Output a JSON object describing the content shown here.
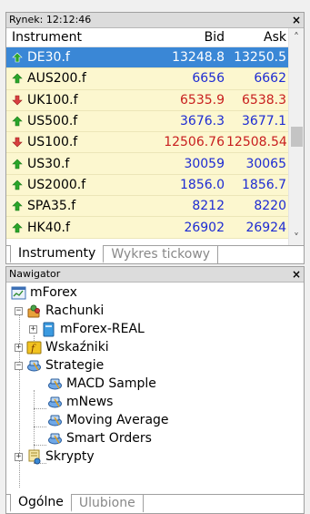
{
  "market_watch": {
    "title": "Rynek: 12:12:46",
    "close": "×",
    "columns": {
      "instrument": "Instrument",
      "bid": "Bid",
      "ask": "Ask"
    },
    "rows": [
      {
        "symbol": "DE30.f",
        "bid": "13248.8",
        "ask": "13250.5",
        "dir": "up",
        "selected": true
      },
      {
        "symbol": "AUS200.f",
        "bid": "6656",
        "ask": "6662",
        "dir": "up"
      },
      {
        "symbol": "UK100.f",
        "bid": "6535.9",
        "ask": "6538.3",
        "dir": "down"
      },
      {
        "symbol": "US500.f",
        "bid": "3676.3",
        "ask": "3677.1",
        "dir": "up"
      },
      {
        "symbol": "US100.f",
        "bid": "12506.76",
        "ask": "12508.54",
        "dir": "down"
      },
      {
        "symbol": "US30.f",
        "bid": "30059",
        "ask": "30065",
        "dir": "up"
      },
      {
        "symbol": "US2000.f",
        "bid": "1856.0",
        "ask": "1856.7",
        "dir": "up"
      },
      {
        "symbol": "SPA35.f",
        "bid": "8212",
        "ask": "8220",
        "dir": "up"
      },
      {
        "symbol": "HK40.f",
        "bid": "26902",
        "ask": "26924",
        "dir": "up"
      }
    ],
    "tabs": [
      "Instrumenty",
      "Wykres tickowy"
    ],
    "colors": {
      "up": "#1d2bd3",
      "down": "#c81e1e",
      "row_bg": "#fcf7cf",
      "selected_bg": "#3a87d6"
    }
  },
  "navigator": {
    "title": "Nawigator",
    "close": "×",
    "root": "mForex",
    "accounts": "Rachunki",
    "account_item": "mForex-REAL",
    "indicators": "Wskaźniki",
    "strategies": "Strategie",
    "strategy_items": [
      "MACD Sample",
      "mNews",
      "Moving Average",
      "Smart Orders"
    ],
    "scripts": "Skrypty",
    "tabs": [
      "Ogólne",
      "Ulubione"
    ]
  }
}
